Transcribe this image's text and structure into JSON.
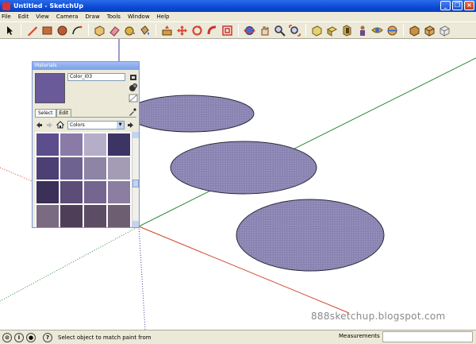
{
  "window": {
    "title": "Untitled - SketchUp",
    "min_label": "_",
    "max_label": "❐",
    "close_label": "×"
  },
  "menu": [
    "File",
    "Edit",
    "View",
    "Camera",
    "Draw",
    "Tools",
    "Window",
    "Help"
  ],
  "toolbar": {
    "tools": [
      "select-tool",
      "pencil-tool",
      "rectangle-tool",
      "circle-tool",
      "arc-tool",
      "make-component-tool",
      "eraser-tool",
      "tape-measure-tool",
      "paint-bucket-tool",
      "push-pull-tool",
      "move-tool",
      "rotate-tool",
      "follow-me-tool",
      "offset-tool",
      "orbit-tool",
      "pan-tool",
      "zoom-tool",
      "zoom-extents-tool",
      "iso-view",
      "top-view",
      "front-view",
      "right-view",
      "back-view",
      "left-view",
      "xray-view",
      "wireframe-view"
    ]
  },
  "materials": {
    "title": "Materials",
    "material_name": "Color_I03",
    "tabs": [
      "Select",
      "Edit"
    ],
    "collection": "Colors",
    "swatch_color": "#6a5a9a",
    "swatches": [
      "#5c4d8c",
      "#8a7aa8",
      "#b4aec8",
      "#3c3464",
      "#4c3f74",
      "#6e6290",
      "#8e84a6",
      "#a49cb4",
      "#3a3058",
      "#5c4c78",
      "#74668e",
      "#8c7ea0",
      "#7a6a82",
      "#4e3e58",
      "#5c4c64",
      "#6e5e72"
    ]
  },
  "status": {
    "message": "Select object to match paint from",
    "measurements_label": "Measurements",
    "measurements_value": ""
  },
  "watermark": "888sketchup.blogspot.com",
  "colors": {
    "ellipse_fill": "#8c87b4",
    "axis_red": "#d0452a",
    "axis_green": "#2e8a3a",
    "axis_blue": "#3a3a9a"
  }
}
